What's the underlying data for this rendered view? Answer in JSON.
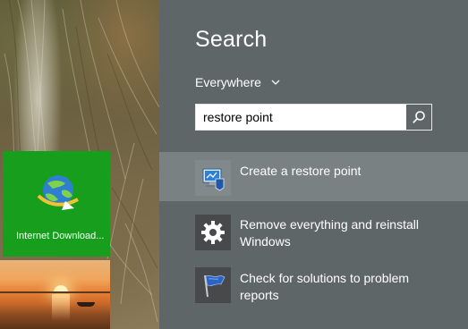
{
  "start_screen": {
    "tiles": [
      {
        "label": "Internet Download...",
        "icon": "idm-globe-icon",
        "color": "#169e1c"
      },
      {
        "label": "",
        "icon": "sunset-photo"
      }
    ]
  },
  "search": {
    "title": "Search",
    "scope": "Everywhere",
    "query": "restore point",
    "search_button_icon": "magnifier-icon"
  },
  "results": [
    {
      "label": "Create a restore point",
      "icon": "system-protection-icon",
      "selected": true
    },
    {
      "label": "Remove everything and reinstall Windows",
      "icon": "gear-icon",
      "selected": false
    },
    {
      "label": "Check for solutions to problem reports",
      "icon": "action-center-flag-icon",
      "selected": false
    }
  ],
  "colors": {
    "pane_bg": "#5f6668",
    "selected_bg": "#798183",
    "tile_green": "#169e1c"
  }
}
